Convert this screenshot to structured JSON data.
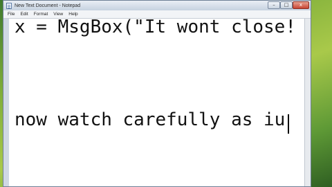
{
  "window": {
    "title": "New Text Document - Notepad",
    "controls": {
      "minimize": "–",
      "maximize": "□",
      "close": "x"
    }
  },
  "menu": {
    "items": [
      "File",
      "Edit",
      "Format",
      "View",
      "Help"
    ]
  },
  "document": {
    "lines": [
      "x = MsgBox(\"It wont close!",
      "now watch carefully as iu"
    ]
  },
  "colors": {
    "desktop": "#7fae3a",
    "close_button": "#c84634"
  }
}
